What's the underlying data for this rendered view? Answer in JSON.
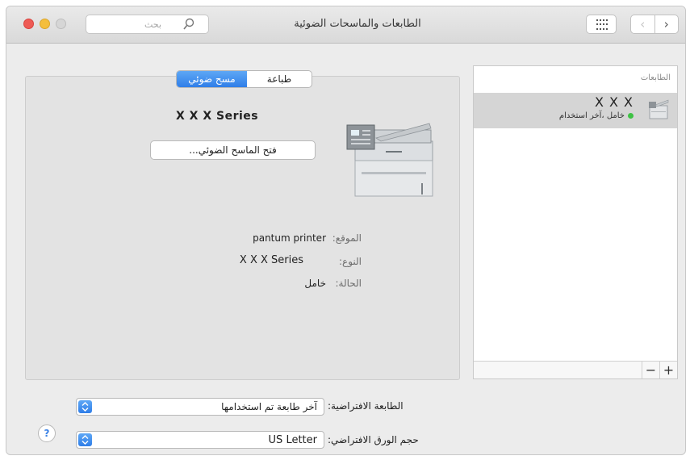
{
  "window": {
    "title": "الطابعات والماسحات الضوئية",
    "search_placeholder": "بحث"
  },
  "printers_list": {
    "header": "الطابعات",
    "items": [
      {
        "name": "X X X",
        "status": "خامل ،آخر استخدام",
        "status_color": "#3ec244"
      }
    ],
    "add_label": "+",
    "remove_label": "−"
  },
  "details": {
    "tabs": [
      {
        "label": "طباعة",
        "selected": false
      },
      {
        "label": "مسح ضوئي",
        "selected": true
      }
    ],
    "device_title": "X X X Series",
    "open_scanner_label": "فتح الماسح الضوئي...",
    "location": {
      "label": "الموقع:",
      "value": "pantum printer"
    },
    "kind": {
      "label": "النوع:",
      "value": "X X X Series"
    },
    "status": {
      "label": "الحالة:",
      "value": "خامل"
    }
  },
  "defaults": {
    "default_printer": {
      "label": "الطابعة الافتراضية:",
      "value": "آخر طابعة تم استخدامها"
    },
    "paper_size": {
      "label": "حجم الورق الافتراضي:",
      "value": "US Letter"
    }
  },
  "colors": {
    "accent": "#2f7ee8",
    "status_idle": "#3ec244"
  },
  "icons": {
    "search": "search-icon",
    "grid": "grid-icon",
    "back": "chevron-left-icon",
    "forward": "chevron-right-icon",
    "help": "help-icon"
  }
}
